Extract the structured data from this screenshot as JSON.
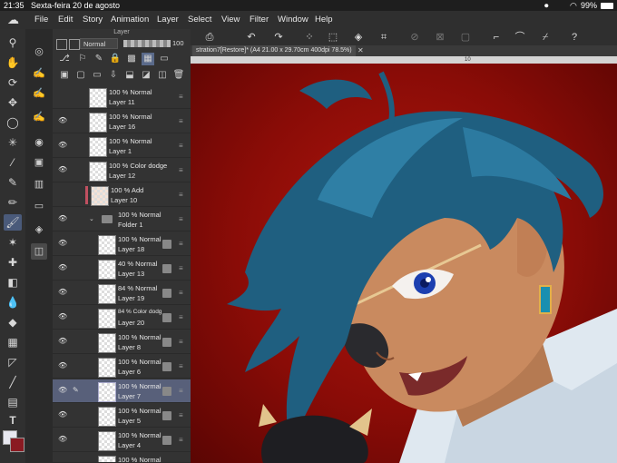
{
  "status_bar": {
    "time": "21:35",
    "date": "Sexta-feira 20 de agosto",
    "battery": "99%"
  },
  "menu": [
    "File",
    "Edit",
    "Story",
    "Animation",
    "Layer",
    "Select",
    "View",
    "Filter",
    "Window",
    "Help"
  ],
  "layer_panel": {
    "title": "Layer",
    "blend_mode": "Normal",
    "opacity": "100"
  },
  "document": {
    "tab_title": "stration7[Restore]* (A4 21.00 x 29.70cm 400dpi 78.5%)",
    "ruler_tick": "10"
  },
  "layers": [
    {
      "mode": "100 % Normal",
      "name": "Layer 11",
      "visible": false,
      "selected": false
    },
    {
      "mode": "100 % Normal",
      "name": "Layer 16",
      "visible": true,
      "selected": false
    },
    {
      "mode": "100 % Normal",
      "name": "Layer 1",
      "visible": true,
      "selected": false
    },
    {
      "mode": "100 % Color dodge",
      "name": "Layer 12",
      "visible": true,
      "selected": false
    },
    {
      "mode": "100 % Add",
      "name": "Layer 10",
      "visible": false,
      "selected": false
    },
    {
      "mode": "100 % Normal",
      "name": "Folder 1",
      "visible": true,
      "selected": false,
      "folder": true
    },
    {
      "mode": "100 % Normal",
      "name": "Layer 18",
      "visible": true,
      "selected": false
    },
    {
      "mode": "40 % Normal",
      "name": "Layer 13",
      "visible": true,
      "selected": false
    },
    {
      "mode": "84 % Normal",
      "name": "Layer 19",
      "visible": true,
      "selected": false
    },
    {
      "mode": "84 % Color dodg",
      "name": "Layer 20",
      "visible": true,
      "selected": false
    },
    {
      "mode": "100 % Normal",
      "name": "Layer 8",
      "visible": true,
      "selected": false
    },
    {
      "mode": "100 % Normal",
      "name": "Layer 6",
      "visible": true,
      "selected": false
    },
    {
      "mode": "100 % Normal",
      "name": "Layer 7",
      "visible": true,
      "selected": true
    },
    {
      "mode": "100 % Normal",
      "name": "Layer 5",
      "visible": true,
      "selected": false
    },
    {
      "mode": "100 % Normal",
      "name": "Layer 4",
      "visible": true,
      "selected": false
    },
    {
      "mode": "100 % Normal",
      "name": "",
      "visible": true,
      "selected": false
    }
  ],
  "colors": {
    "main": "#e8e8f0",
    "sub": "#8a1a22",
    "canvas_bg": "#9b100a",
    "hair": "#1f5f80",
    "skin": "#c98a5f"
  }
}
